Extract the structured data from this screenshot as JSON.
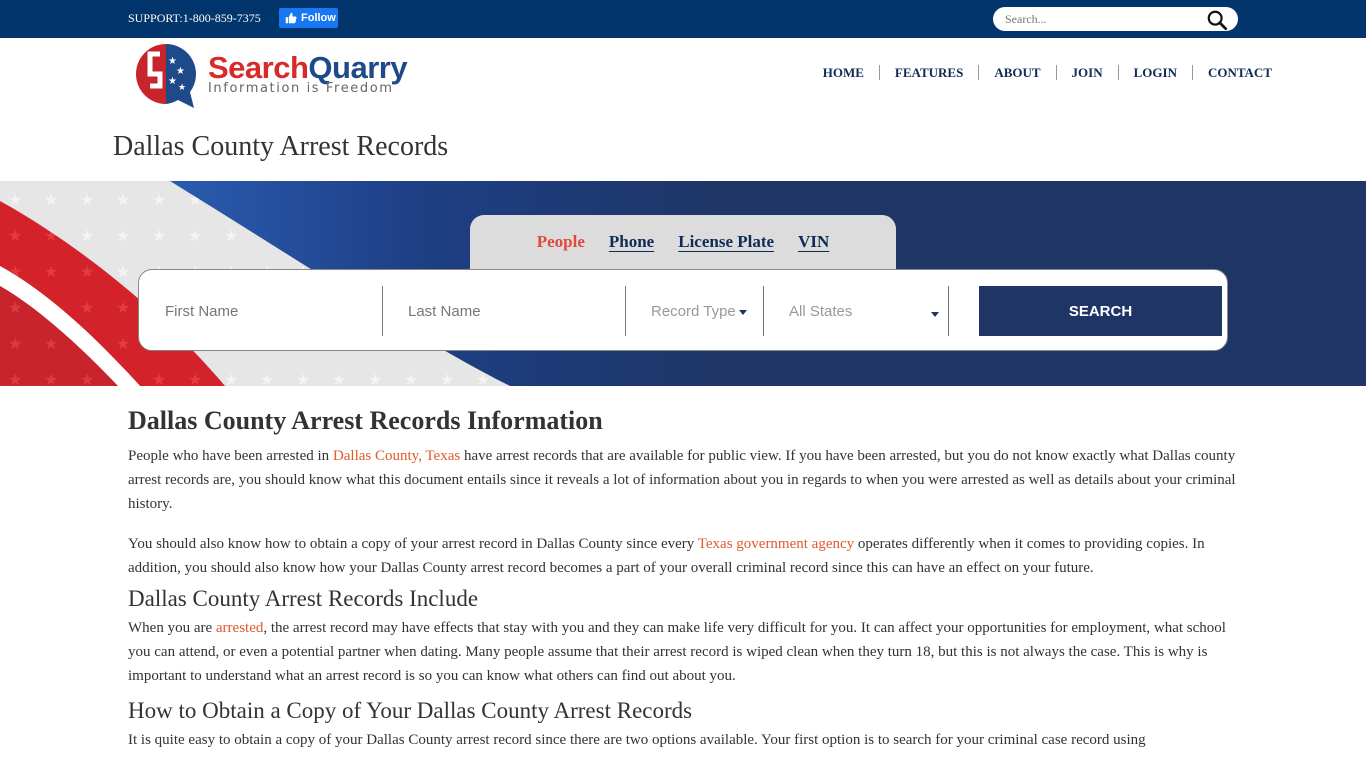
{
  "topbar": {
    "support": "SUPPORT:1-800-859-7375",
    "follow_label": "Follow",
    "search_placeholder": "Search..."
  },
  "header": {
    "logo_primary": "Search",
    "logo_secondary": "Quarry",
    "logo_tagline": "Information is Freedom",
    "nav": [
      {
        "label": "HOME"
      },
      {
        "label": "FEATURES"
      },
      {
        "label": "ABOUT"
      },
      {
        "label": "JOIN"
      },
      {
        "label": "LOGIN"
      },
      {
        "label": "CONTACT"
      }
    ]
  },
  "page_title": "Dallas County Arrest Records",
  "search": {
    "tabs": [
      {
        "label": "People",
        "active": true
      },
      {
        "label": "Phone"
      },
      {
        "label": "License Plate"
      },
      {
        "label": "VIN"
      }
    ],
    "first_name_placeholder": "First Name",
    "last_name_placeholder": "Last Name",
    "record_type": "Record Type",
    "state": "All States",
    "button": "SEARCH"
  },
  "colors": {
    "navy": "#01356b",
    "banner_navy": "#1e3566",
    "link_orange": "#e05a2b",
    "tab_active_red": "#df4a3a"
  },
  "article": {
    "heading": "Dallas County Arrest Records Information",
    "p1": {
      "before": "People who have been arrested in ",
      "link": "Dallas County, Texas",
      "after": " have arrest records that are available for public view. If you have been arrested, but you do not know exactly what Dallas county arrest records are, you should know what this document entails since it reveals a lot of information about you in regards to when you were arrested as well as details about your criminal history."
    },
    "p2": {
      "before": "You should also know how to obtain a copy of your arrest record in Dallas County since every ",
      "link": "Texas government agency",
      "after": " operates differently when it comes to providing copies. In addition, you should also know how your Dallas County arrest record becomes a part of your overall criminal record since this can have an effect on your future."
    },
    "h2_include": "Dallas County Arrest Records Include",
    "p3": {
      "before": "When you are ",
      "link": "arrested",
      "after": ", the arrest record may have effects that stay with you and they can make life very difficult for you. It can affect your opportunities for employment, what school you can attend, or even a potential partner when dating. Many people assume that their arrest record is wiped clean when they turn 18, but this is not always the case. This is why is important to understand what an arrest record is so you can know what others can find out about you."
    },
    "h2_obtain": "How to Obtain a Copy of Your Dallas County Arrest Records",
    "p4": "It is quite easy to obtain a copy of your Dallas County arrest record since there are two options available. Your first option is to search for your criminal case record using"
  }
}
